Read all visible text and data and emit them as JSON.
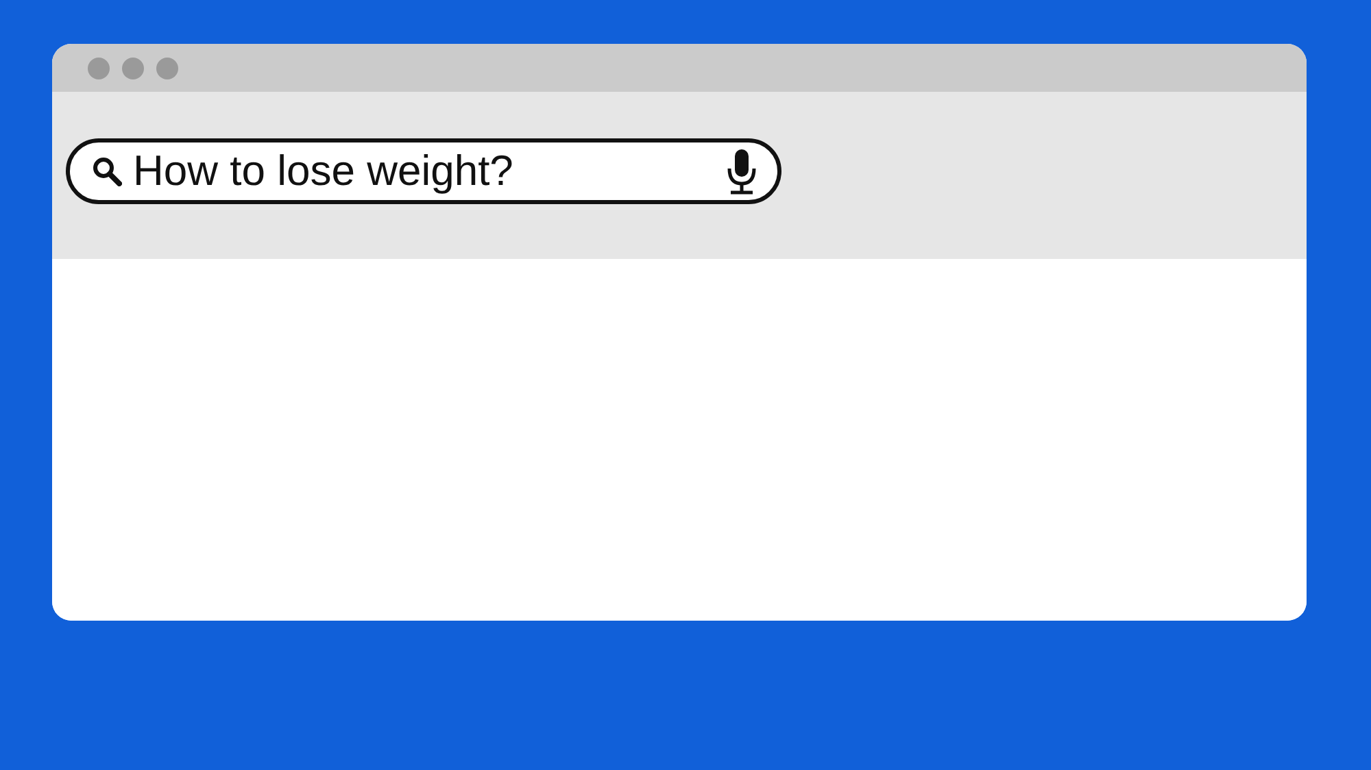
{
  "search": {
    "value": "How to lose weight?"
  }
}
